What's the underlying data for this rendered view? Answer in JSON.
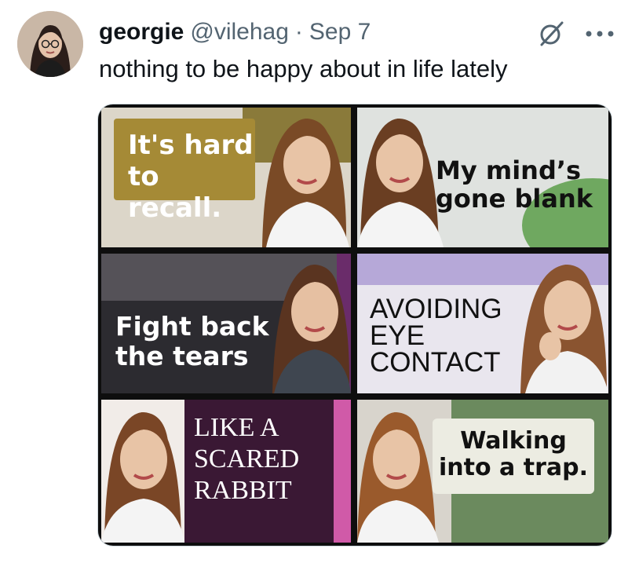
{
  "tweet": {
    "author_name": "georgie",
    "handle": "@vilehag",
    "separator": "·",
    "date": "Sep 7",
    "text": "nothing to be happy about in life lately",
    "grok_icon": "grok-slash-circle-icon",
    "more_icon": "ellipsis-icon"
  },
  "media": {
    "captions": [
      "It's hard\nto recall.",
      "My mind’s\ngone blank",
      "Fight back\nthe tears",
      "AVOIDING\nEYE\nCONTACT",
      "LIKE A\nSCARED\nRABBIT",
      "Walking\ninto a trap."
    ]
  },
  "colors": {
    "name": "#0f1419",
    "secondary_text": "#536471",
    "border": "#cfd9de"
  }
}
